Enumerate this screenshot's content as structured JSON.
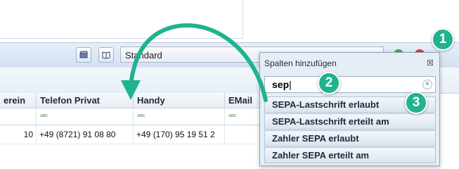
{
  "toolbar": {
    "view_value": "Standard",
    "book_icon_a": "book-stack-icon",
    "book_icon_b": "open-book-icon"
  },
  "grid": {
    "columns": [
      "erein",
      "Telefon Privat",
      "Handy",
      "EMail"
    ],
    "filter_glyph": "ᴀʙᴄ",
    "row1": {
      "c0": "10",
      "c1": "+49 (8721) 91 08 80",
      "c2": "+49 (170) 95 19 51 2",
      "c3": ""
    }
  },
  "popup": {
    "title": "Spalten hinzufügen",
    "close": "☒",
    "search_value": "sep",
    "results": [
      "SEPA-Lastschrift erlaubt",
      "SEPA-Lastschrift erteilt am",
      "Zahler SEPA erlaubt",
      "Zahler SEPA erteilt am"
    ]
  },
  "badges": [
    "1",
    "2",
    "3"
  ],
  "colors": {
    "accent": "#1fb38f",
    "header_bg": "#e6ecf3"
  }
}
